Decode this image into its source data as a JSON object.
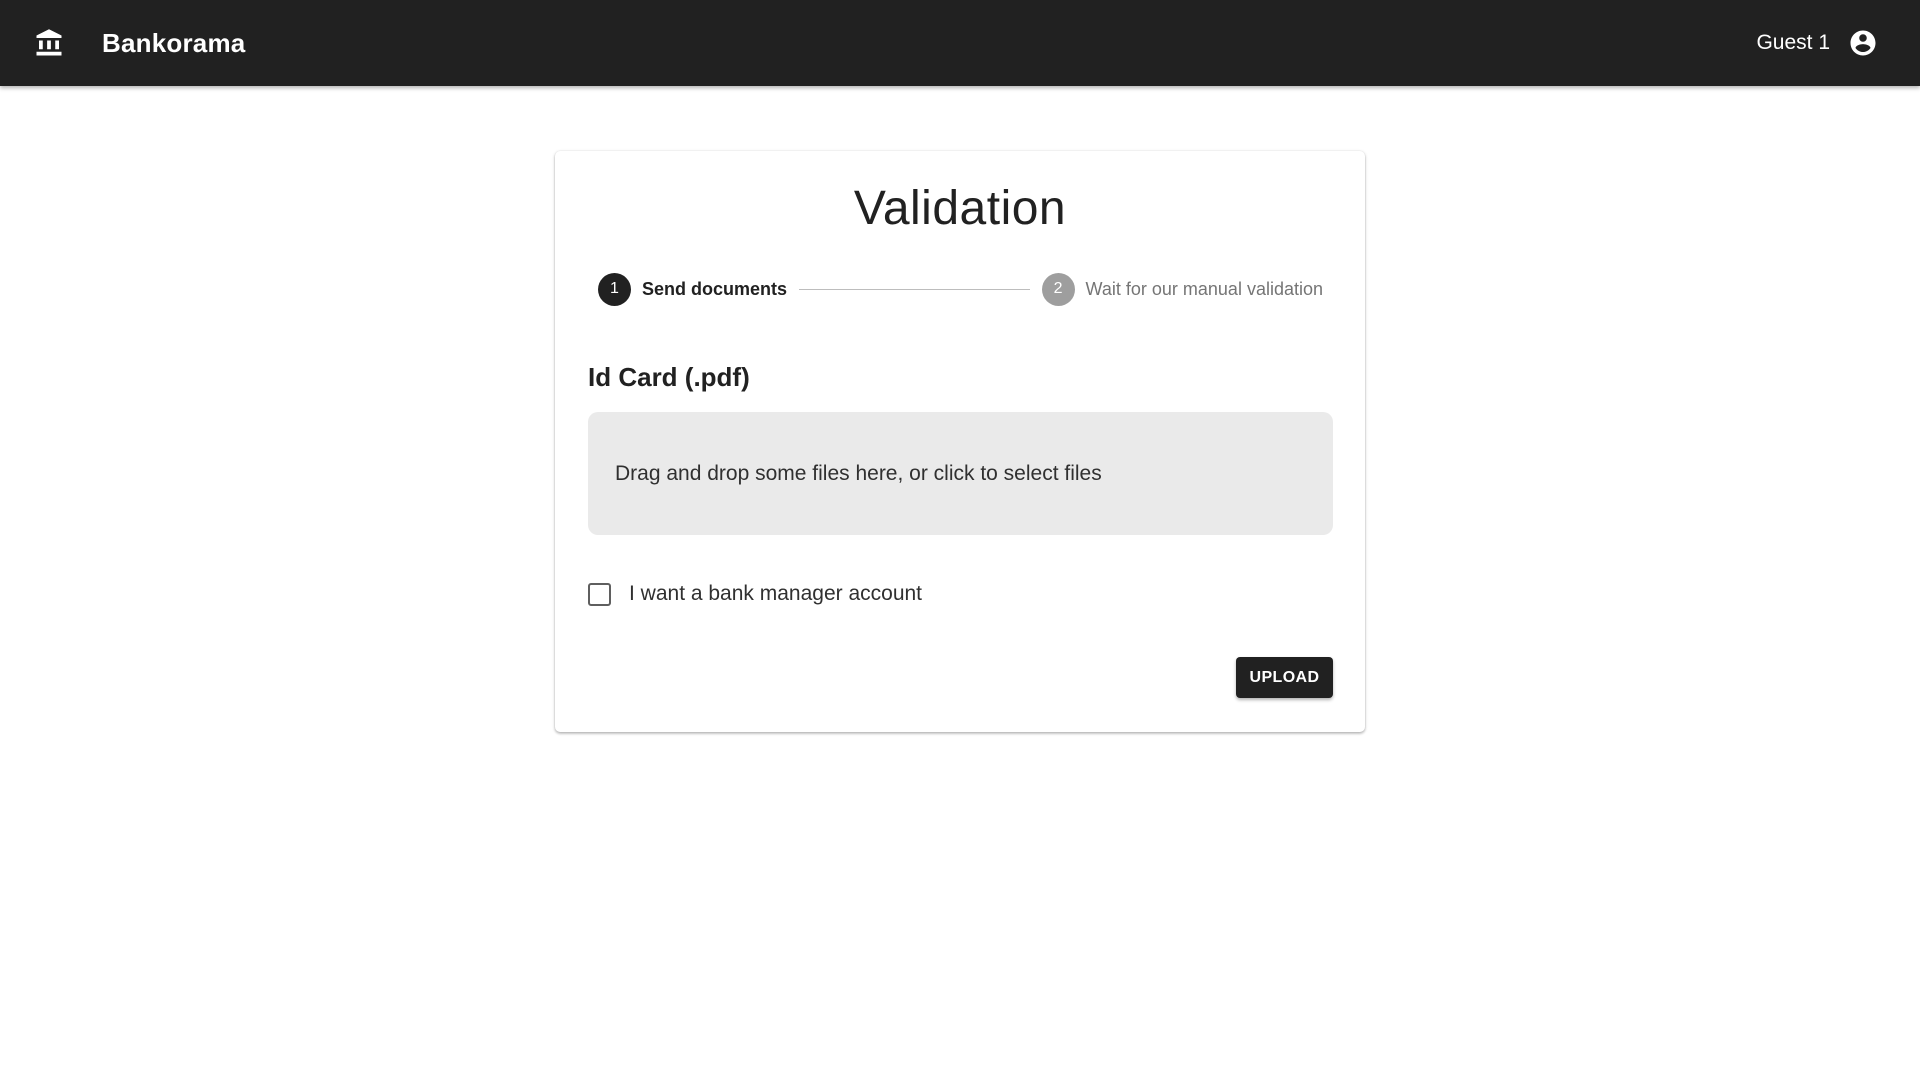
{
  "header": {
    "brand": "Bankorama",
    "user_name": "Guest 1",
    "icons": {
      "brand_icon": "bank-icon",
      "user_icon": "account-circle-icon"
    },
    "colors": {
      "appbar_bg": "#212121",
      "appbar_text": "#ffffff"
    }
  },
  "card": {
    "title": "Validation",
    "stepper": {
      "steps": [
        {
          "number": "1",
          "label": "Send documents",
          "state": "active"
        },
        {
          "number": "2",
          "label": "Wait for our manual validation",
          "state": "inactive"
        }
      ]
    },
    "id_card": {
      "label": "Id Card (.pdf)",
      "dropzone_text": "Drag and drop some files here, or click to select files"
    },
    "manager_checkbox": {
      "label": "I want a bank manager account",
      "checked": false
    },
    "upload_button": {
      "label": "UPLOAD"
    }
  }
}
